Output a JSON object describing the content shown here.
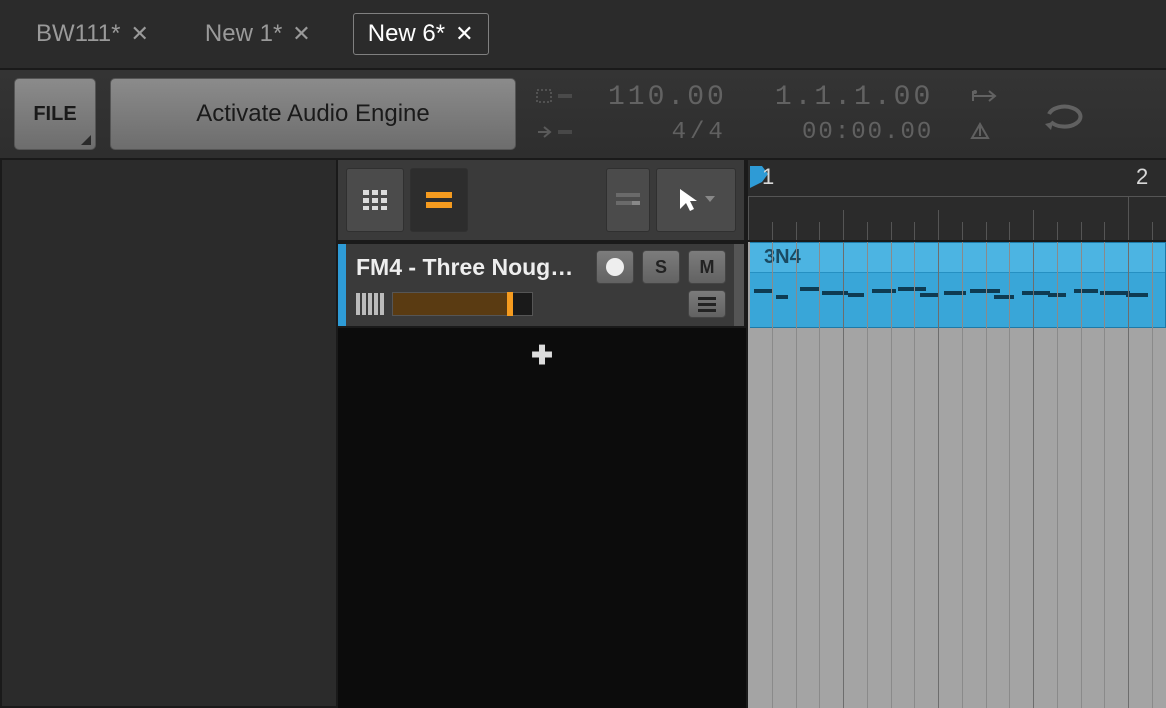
{
  "tabs": [
    {
      "label": "BW111*"
    },
    {
      "label": "New 1*"
    },
    {
      "label": "New 6*"
    }
  ],
  "active_tab": 2,
  "toolbar": {
    "file_label": "FILE",
    "activate_label": "Activate Audio Engine",
    "tempo": "110.00",
    "time_sig": "4/4",
    "position": "1.1.1.00",
    "timecode": "00:00.00"
  },
  "track_toolbar": {
    "grid_icon": "grid-icon",
    "layout_icon": "layout-icon",
    "automation_icon": "automation-icon",
    "tool_icon": "pointer-tool-icon"
  },
  "track": {
    "name": "FM4 - Three Noug…",
    "solo_label": "S",
    "mute_label": "M"
  },
  "ruler": {
    "labels": [
      "1",
      "2"
    ]
  },
  "clip": {
    "name": "3N4"
  },
  "colors": {
    "accent": "#f59b1f",
    "track_blue": "#39a6d8"
  }
}
